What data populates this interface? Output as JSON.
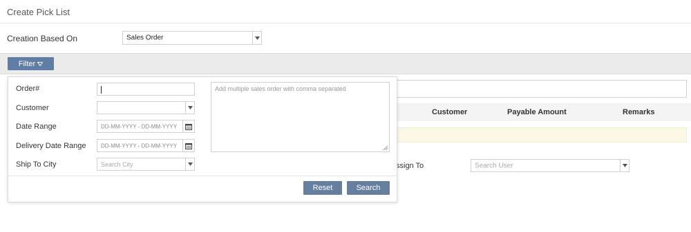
{
  "header": {
    "title": "Create Pick List"
  },
  "creation": {
    "label": "Creation Based On",
    "selected": "Sales Order"
  },
  "filter": {
    "button_label": "Filter",
    "icon": "chevron-down-icon"
  },
  "table": {
    "columns": [
      "Customer",
      "Payable Amount",
      "Remarks"
    ]
  },
  "assign": {
    "label": "ssign To",
    "placeholder": "Search User"
  },
  "filter_panel": {
    "order": {
      "label": "Order#",
      "value": ""
    },
    "customer": {
      "label": "Customer",
      "value": ""
    },
    "date_range": {
      "label": "Date Range",
      "placeholder": "DD-MM-YYYY - DD-MM-YYYY"
    },
    "delivery_date_range": {
      "label": "Delivery Date Range",
      "placeholder": "DD-MM-YYYY - DD-MM-YYYY"
    },
    "ship_to_city": {
      "label": "Ship To City",
      "placeholder": "Search City"
    },
    "orders_textarea": {
      "placeholder": "Add multiple sales order with comma separated"
    },
    "reset_label": "Reset",
    "search_label": "Search"
  },
  "colors": {
    "accent": "#5f7da5",
    "button": "#667f9f",
    "notice": "#fdf7e6",
    "strip": "#ebebeb"
  }
}
